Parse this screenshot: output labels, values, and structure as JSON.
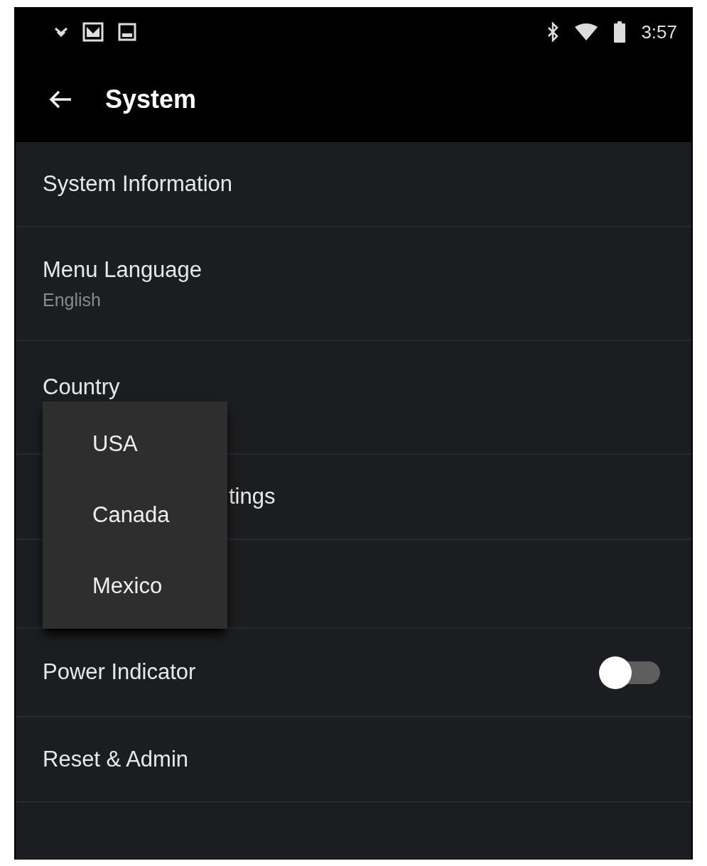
{
  "status_bar": {
    "time": "3:57"
  },
  "header": {
    "title": "System"
  },
  "rows": [
    {
      "kind": "plain",
      "label": "System Information"
    },
    {
      "kind": "subtitle",
      "label": "Menu Language",
      "value": "English"
    },
    {
      "kind": "plain",
      "label": "Country"
    },
    {
      "kind": "covered",
      "label": "tings"
    },
    {
      "kind": "empty"
    },
    {
      "kind": "toggle",
      "label": "Power Indicator",
      "on": false
    },
    {
      "kind": "plain",
      "label": "Reset & Admin"
    }
  ],
  "popup": {
    "items": [
      {
        "label": "USA"
      },
      {
        "label": "Canada"
      },
      {
        "label": "Mexico"
      }
    ]
  }
}
